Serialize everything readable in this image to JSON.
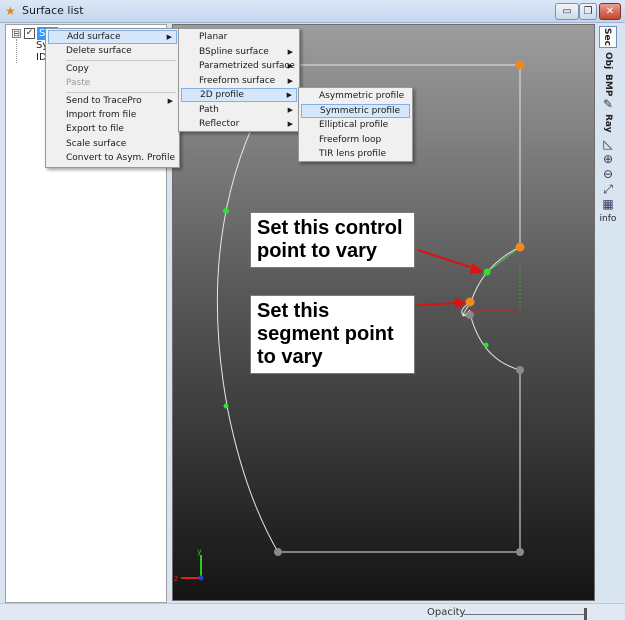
{
  "window": {
    "title": "Surface list",
    "minimize_glyph": "▭",
    "restore_glyph": "❐",
    "close_glyph": "✕"
  },
  "tree": {
    "expander": "⊟",
    "check": "✓",
    "root_label": "Sur",
    "children": [
      "Sy",
      "ID:"
    ]
  },
  "context_menu": {
    "items": [
      {
        "label": "Add surface",
        "submenu": true,
        "highlighted": true
      },
      {
        "label": "Delete surface"
      },
      {
        "label": "Copy"
      },
      {
        "label": "Paste",
        "disabled": true
      },
      {
        "label": "Send to TracePro",
        "submenu": true
      },
      {
        "label": "Import from file"
      },
      {
        "label": "Export to file"
      },
      {
        "label": "Scale surface"
      },
      {
        "label": "Convert to Asym. Profile"
      }
    ]
  },
  "add_surface_menu": {
    "items": [
      {
        "label": "Planar"
      },
      {
        "label": "BSpline surface",
        "submenu": true
      },
      {
        "label": "Parametrized surface",
        "submenu": true
      },
      {
        "label": "Freeform surface",
        "submenu": true
      },
      {
        "label": "2D profile",
        "submenu": true,
        "highlighted": true
      },
      {
        "label": "Path",
        "submenu": true
      },
      {
        "label": "Reflector",
        "submenu": true
      }
    ]
  },
  "profile_menu": {
    "items": [
      {
        "label": "Asymmetric profile"
      },
      {
        "label": "Symmetric profile",
        "highlighted": true
      },
      {
        "label": "Elliptical profile"
      },
      {
        "label": "Freeform loop"
      },
      {
        "label": "TIR lens profile"
      }
    ]
  },
  "annotations": {
    "control_point": "Set this control\npoint to vary",
    "segment_point": "Set this\nsegment point\nto vary"
  },
  "toolbar": {
    "sec_label": "Sec",
    "obj_label": "Obj",
    "bmp_label": "BMP",
    "ray_label": "Ray",
    "info_label": "info",
    "icons": [
      "pencil-icon",
      "measure-icon",
      "zoom-in-icon",
      "zoom-out-icon",
      "fit-icon",
      "grid-icon"
    ]
  },
  "axis_glyphs": {
    "y": "y",
    "z": "z"
  },
  "status": {
    "opacity_label": "Opacity",
    "opacity_value": 1.0
  },
  "colors": {
    "accent_orange": "#f08a1c",
    "point_green": "#33dd33",
    "point_grey": "#8a8a8a",
    "arrow_red": "#e01010",
    "selection_blue": "#3399ff"
  }
}
